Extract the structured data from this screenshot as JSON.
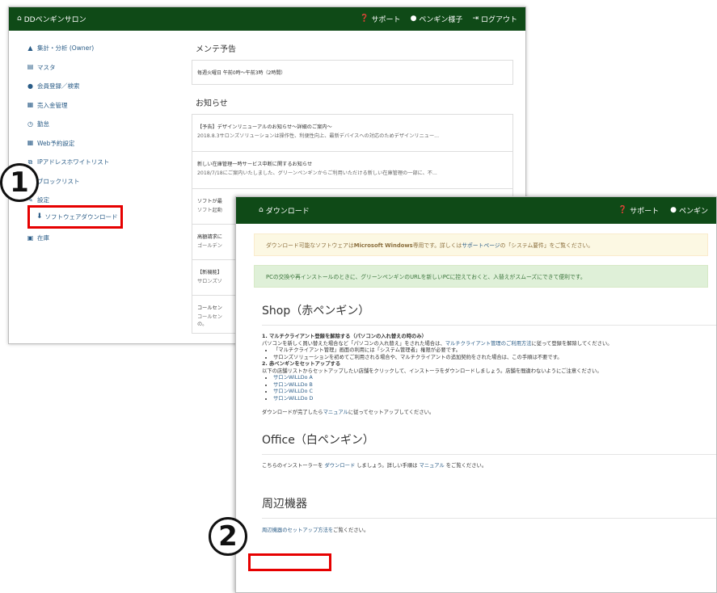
{
  "win1": {
    "brand": "DDペンギンサロン",
    "nav": [
      "サポート",
      "ペンギン様子",
      "ログアウト"
    ],
    "sidebar": [
      {
        "icon": "chart-icon",
        "label": "集計・分析 (Owner)"
      },
      {
        "icon": "list-icon",
        "label": "マスタ"
      },
      {
        "icon": "user-icon",
        "label": "会員登録／検索"
      },
      {
        "icon": "card-icon",
        "label": "売入金管理"
      },
      {
        "icon": "clock-icon",
        "label": "勤怠"
      },
      {
        "icon": "calendar-icon",
        "label": "Web予約設定"
      },
      {
        "icon": "network-icon",
        "label": "IPアドレスホワイトリスト"
      },
      {
        "icon": "user-block-icon",
        "label": "ブロックリスト"
      },
      {
        "icon": "wrench-icon",
        "label": "設定"
      },
      {
        "icon": "download-icon",
        "label": "ソフトウェアダウンロード"
      },
      {
        "icon": "gift-icon",
        "label": "在庫"
      }
    ],
    "maint_title": "メンテ予告",
    "maint_text": "毎週火曜日 午前0時〜午前3時（2時間）",
    "news_title": "お知らせ",
    "news": [
      {
        "title": "【予告】デザインリニューアルのお知らせ〜詳細のご案内〜",
        "summary": "2018.8.3サロンズソリューションは操作性、利便性向上、最新デバイスへの対応のためデザインリニュー..."
      },
      {
        "title": "新しい在庫管理一時サービス中断に関するお知らせ",
        "summary": "2018/7/18にご案内いたしました、グリーンペンギンからご利用いただける新しい在庫管理の一部に、不..."
      },
      {
        "title": "ソフトが最",
        "summary": "ソフト起動"
      },
      {
        "title": "高額請求に",
        "summary": "ゴールデン"
      },
      {
        "title": "【新機能】",
        "summary": "サロンズソ"
      },
      {
        "title": "コールセン",
        "summary": "コールセン"
      }
    ],
    "news_tail": "の。"
  },
  "marker1": "1",
  "marker2": "2",
  "win2": {
    "title": "ダウンロード",
    "nav": [
      "サポート",
      "ペンギン"
    ],
    "alert_warn_pre": "ダウンロード可能なソフトウェアは",
    "alert_warn_bold": "Microsoft Windows",
    "alert_warn_mid": "専用です。詳しくは",
    "alert_warn_link": "サポートページ",
    "alert_warn_post": "の「システム要件」をご覧ください。",
    "alert_ok": "PCの交換や再インストールのときに、グリーンペンギンのURLを新しいPCに控えておくと、入替えがスムーズにできて便利です。",
    "shop_title": "Shop（赤ペンギン）",
    "step1_title": "1. マルチクライアント登録を解除する（パソコンの入れ替えの時のみ）",
    "step1_text_pre": "パソコンを新しく買い替えた場合など「パソコンの入れ替え」をされた場合は、",
    "step1_link": "マルチクライアント管理のご利用方法",
    "step1_text_post": "に従って登録を解除してください。",
    "step1_bullets": [
      "「マルチクライアント管理」画面の利用には「システム管理者」権限が必要です。",
      "サロンズソリューションを初めてご利用される場合や、マルチクライアントの追加契約をされた場合は、この手順は不要です。"
    ],
    "step2_title": "2. 赤ペンギンをセットアップする",
    "step2_text": "以下の店舗リストからセットアップしたい店舗をクリックして、インストーラをダウンロードしましょう。店舗を間違わないようにご注意ください。",
    "stores": [
      "サロンWiLLDo A",
      "サロンWiLLDo B",
      "サロンWiLLDo C",
      "サロンWiLLDo D"
    ],
    "after_pre": "ダウンロードが完了したら",
    "after_link": "マニュアル",
    "after_post": "に従ってセットアップしてください。",
    "office_title": "Office（白ペンギン）",
    "office_pre": "こちらのインストーラーを ",
    "office_link1": "ダウンロード",
    "office_mid": " しましょう。詳しい手順は ",
    "office_link2": "マニュアル",
    "office_post": " をご覧ください。",
    "periph_title": "周辺機器",
    "periph_link": "周辺機器のセットアップ方法を",
    "periph_post": "ご覧ください。"
  }
}
